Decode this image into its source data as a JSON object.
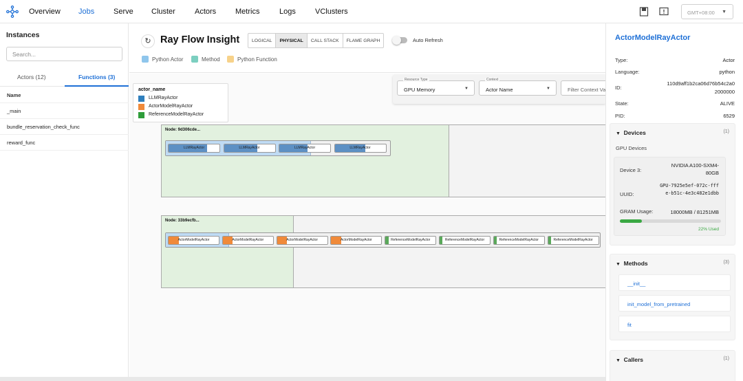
{
  "nav": {
    "items": [
      "Overview",
      "Jobs",
      "Serve",
      "Cluster",
      "Actors",
      "Metrics",
      "Logs",
      "VClusters"
    ],
    "active": "Jobs",
    "timezone": "GMT+08:00"
  },
  "left": {
    "title": "Instances",
    "search_placeholder": "Search...",
    "tabs": [
      "Actors (12)",
      "Functions (3)"
    ],
    "active_tab": "Functions (3)",
    "column_header": "Name",
    "rows": [
      "_main",
      "bundle_reservation_check_func",
      "reward_func"
    ]
  },
  "header": {
    "title": "Ray Flow Insight",
    "views": [
      "LOGICAL",
      "PHYSICAL",
      "CALL STACK",
      "FLAME GRAPH"
    ],
    "active_view": "PHYSICAL",
    "auto_refresh_label": "Auto Refresh",
    "auto_refresh_on": false,
    "legend": [
      {
        "label": "Python Actor",
        "color": "#8fc6ec"
      },
      {
        "label": "Method",
        "color": "#7ccfc0"
      },
      {
        "label": "Python Function",
        "color": "#f7d28a"
      }
    ]
  },
  "filters": {
    "resource_type_label": "Resource Type",
    "resource_type_value": "GPU Memory",
    "context_label": "Context",
    "context_value": "Actor Name",
    "filter_placeholder": "Filter Context Val"
  },
  "actor_legend": {
    "title": "actor_name",
    "items": [
      {
        "label": "LLMRayActor",
        "color": "#2f7fbd"
      },
      {
        "label": "ActorModelRayActor",
        "color": "#f08a3a"
      },
      {
        "label": "ReferenceModelRayActor",
        "color": "#2f9d3a"
      }
    ]
  },
  "nodes": [
    {
      "label": "Node: 9d306cde...",
      "actors": [
        {
          "name": "LLMRayActor",
          "color": "#5d90c4",
          "fill": 0.75
        },
        {
          "name": "LLMRayActor",
          "color": "#5d90c4",
          "fill": 0.65
        },
        {
          "name": "LLMRayActor",
          "color": "#5d90c4",
          "fill": 0.55
        },
        {
          "name": "LLMRayActor",
          "color": "#5d90c4",
          "fill": 0.6
        }
      ]
    },
    {
      "label": "Node: 33b9ecfb...",
      "actors": [
        {
          "name": "ActorModelRayActor",
          "color": "#f08a3a",
          "fill": 0.2
        },
        {
          "name": "ActorModelRayActor",
          "color": "#f08a3a",
          "fill": 0.2
        },
        {
          "name": "ActorModelRayActor",
          "color": "#f08a3a",
          "fill": 0.2
        },
        {
          "name": "ActorModelRayActor",
          "color": "#f08a3a",
          "fill": 0.2
        },
        {
          "name": "ReferenceModelRayActor",
          "color": "#5aa85a",
          "fill": 0.06
        },
        {
          "name": "ReferenceModelRayActor",
          "color": "#5aa85a",
          "fill": 0.06
        },
        {
          "name": "ReferenceModelRayActor",
          "color": "#5aa85a",
          "fill": 0.06
        },
        {
          "name": "ReferenceModelRayActor",
          "color": "#5aa85a",
          "fill": 0.06
        }
      ]
    }
  ],
  "detail": {
    "title": "ActorModelRayActor",
    "fields": [
      {
        "key": "Type:",
        "value": "Actor"
      },
      {
        "key": "Language:",
        "value": "python"
      },
      {
        "key": "ID:",
        "value": "110d9aff1b2ca06d76b54c2a02000000"
      },
      {
        "key": "State:",
        "value": "ALIVE"
      },
      {
        "key": "PID:",
        "value": "6529"
      }
    ],
    "devices": {
      "title": "Devices",
      "count": "(1)",
      "subtitle": "GPU Devices",
      "device_label": "Device 3:",
      "device_value": "NVIDIA A100-SXM4-80GB",
      "uuid_label": "UUID:",
      "uuid_value": "GPU-7925e5ef-072c-fffe-b51c-4e3c482e1dbb",
      "gram_label": "GRAM Usage:",
      "gram_value": "18000MB / 81251MB",
      "gram_used_fraction": 0.22,
      "gram_pct_text": "22% Used"
    },
    "methods": {
      "title": "Methods",
      "count": "(3)",
      "items": [
        "__init__",
        "init_model_from_pretrained",
        "fit"
      ]
    },
    "callers": {
      "title": "Callers",
      "count": "(1)"
    }
  }
}
